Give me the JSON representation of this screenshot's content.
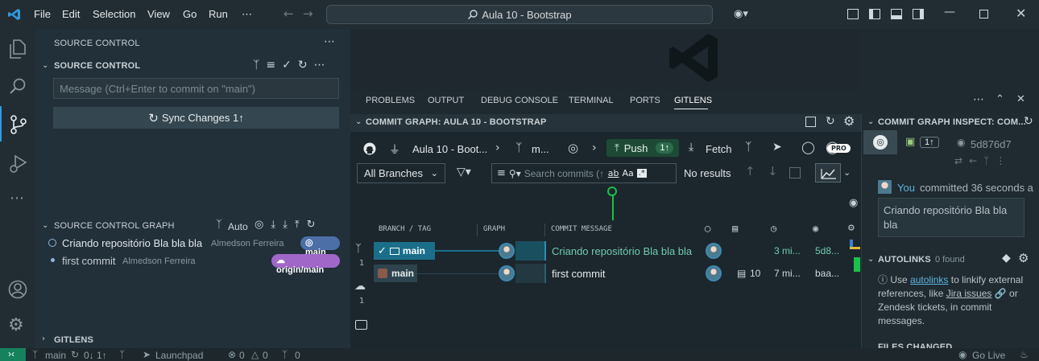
{
  "titlebar": {
    "menu": [
      "File",
      "Edit",
      "Selection",
      "View",
      "Go",
      "Run",
      "⋯"
    ],
    "command_center": "Aula 10 - Bootstrap"
  },
  "sidebar": {
    "title": "SOURCE CONTROL",
    "section": "SOURCE CONTROL",
    "message_placeholder": "Message (Ctrl+Enter to commit on \"main\")",
    "sync_button": "Sync Changes 1↑",
    "graph_section": "SOURCE CONTROL GRAPH",
    "graph_auto": "Auto",
    "graph_items": [
      {
        "message": "Criando repositório Bla bla bla",
        "author": "Almedson Ferreira",
        "badge": "main",
        "badge_color": "#4c6fa8"
      },
      {
        "message": "first commit",
        "author": "Almedson Ferreira",
        "badge": "origin/main",
        "badge_color": "#a067c9"
      }
    ],
    "gitlens_section": "GITLENS"
  },
  "panel": {
    "tabs": [
      "PROBLEMS",
      "OUTPUT",
      "DEBUG CONSOLE",
      "TERMINAL",
      "PORTS",
      "GITLENS"
    ],
    "active_tab": "GITLENS"
  },
  "graph": {
    "title": "COMMIT GRAPH: AULA 10 - BOOTSTRAP",
    "repo": "Aula 10 - Boot...",
    "branch": "m...",
    "push_label": "Push",
    "push_count": "1↑",
    "fetch_label": "Fetch",
    "pro_badge": "PRO",
    "branches_select": "All Branches",
    "search_placeholder": "Search commits (↑",
    "search_opt1": "ab",
    "search_opt2": "Aa",
    "search_opt3": ".*",
    "search_result": "No results",
    "columns": {
      "branch": "BRANCH / TAG",
      "graph": "GRAPH",
      "message": "COMMIT MESSAGE"
    },
    "side_counts": [
      "1",
      "1"
    ],
    "rows": [
      {
        "branch": "main",
        "message": "Criando repositório Bla bla bla",
        "files": "",
        "time": "3 mi...",
        "sha": "5d8..."
      },
      {
        "branch": "main",
        "message": "first commit",
        "files": "10",
        "time": "7 mi...",
        "sha": "baa..."
      }
    ]
  },
  "inspect": {
    "title": "COMMIT GRAPH INSPECT: COM...",
    "count": "1↑",
    "sha": "5d876d7",
    "author": "You",
    "committed": "committed 36 seconds a",
    "commit_message": "Criando repositório Bla bla bla",
    "autolinks_title": "AUTOLINKS",
    "autolinks_count": "0 found",
    "autolinks_text_1": "Use",
    "autolinks_link": "autolinks",
    "autolinks_text_2": "to linkify external references, like",
    "jira_link": "Jira issues",
    "autolinks_text_3": "or Zendesk tickets, in commit messages.",
    "files_changed": "FILES CHANGED"
  },
  "statusbar": {
    "branch": "main",
    "sync": "0↓ 1↑",
    "launchpad": "Launchpad",
    "errors": "0",
    "warnings": "0",
    "ports": "0",
    "go_live": "Go Live"
  }
}
